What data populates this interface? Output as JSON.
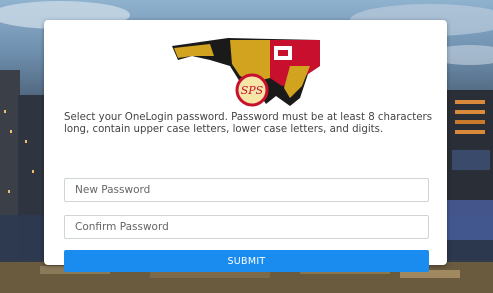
{
  "logo": {
    "seal_text": "SPS"
  },
  "form": {
    "instructions": "Select your OneLogin password. Password must be at least 8 characters long, contain upper case letters, lower case letters, and digits.",
    "new_password_placeholder": "New Password",
    "confirm_password_placeholder": "Confirm Password",
    "submit_label": "SUBMIT"
  },
  "colors": {
    "submit_button": "#1a8cf0",
    "card_background": "#ffffff",
    "sky": "#8fb2cf"
  }
}
